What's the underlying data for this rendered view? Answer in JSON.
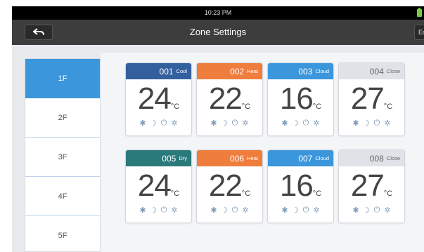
{
  "status": {
    "time": "10:23 PM"
  },
  "header": {
    "title": "Zone Settings",
    "edit_label": "Ed"
  },
  "floors": [
    "1F",
    "2F",
    "3F",
    "4F",
    "5F"
  ],
  "active_floor": "1F",
  "colors": {
    "cool": "#345f9e",
    "heat": "#ef7d3d",
    "cloud": "#3b96dc",
    "close": "#dfe2e6",
    "dry": "#2a7a7b"
  },
  "zones": [
    {
      "number": "001",
      "mode": "Cool",
      "temp": "24",
      "unit": "°C"
    },
    {
      "number": "002",
      "mode": "Heat",
      "temp": "22",
      "unit": "°C"
    },
    {
      "number": "003",
      "mode": "Cloud",
      "temp": "16",
      "unit": "°C"
    },
    {
      "number": "004",
      "mode": "Close",
      "temp": "27",
      "unit": "°C"
    },
    {
      "number": "005",
      "mode": "Dry",
      "temp": "24",
      "unit": "°C"
    },
    {
      "number": "006",
      "mode": "Heat",
      "temp": "22",
      "unit": "°C"
    },
    {
      "number": "007",
      "mode": "Cloud",
      "temp": "16",
      "unit": "°C"
    },
    {
      "number": "008",
      "mode": "Close",
      "temp": "27",
      "unit": "°C"
    }
  ],
  "card_icons": [
    "fan-icon",
    "sleep-icon",
    "power-icon",
    "settings-icon"
  ]
}
